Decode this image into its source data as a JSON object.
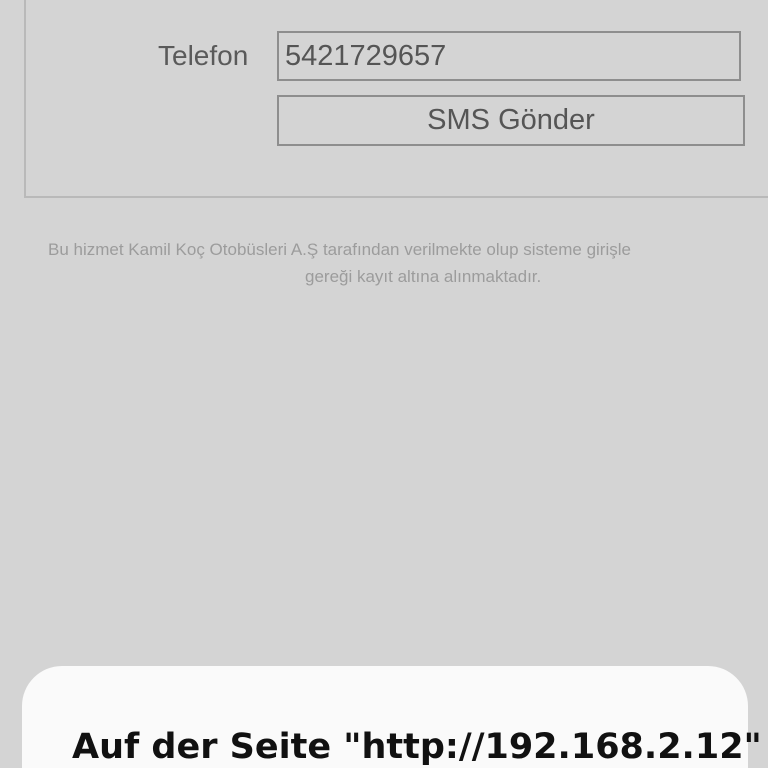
{
  "form": {
    "phone_label": "Telefon",
    "phone_value": "5421729657",
    "sms_button_label": "SMS Gönder"
  },
  "disclaimer": {
    "line1": "Bu hizmet Kamil Koç Otobüsleri A.Ş tarafından verilmekte olup sisteme girişle",
    "line2": "gereği kayıt altına alınmaktadır."
  },
  "dialog": {
    "title": "Auf der Seite \"http://192.168.2.12\""
  },
  "colors": {
    "page_background": "#d4d4d4",
    "dialog_background": "#fafafa",
    "field_border": "#8e8e8e",
    "text_muted": "#5a5a5a"
  }
}
